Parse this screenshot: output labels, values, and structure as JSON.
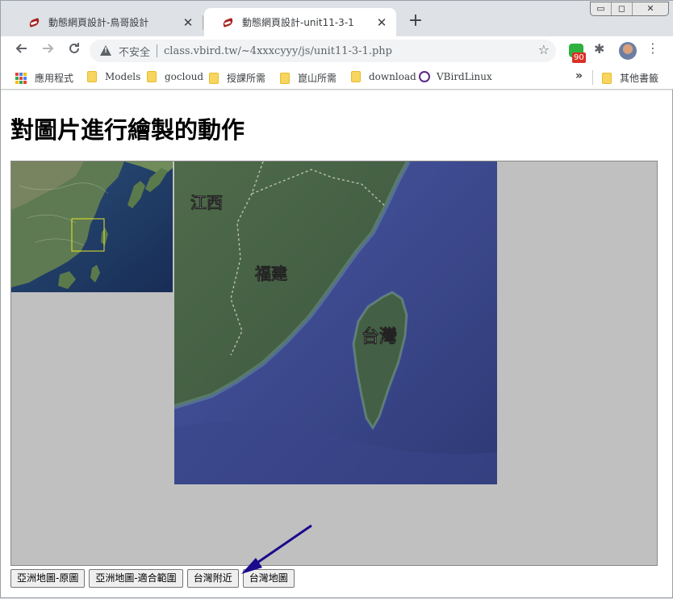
{
  "tabs": [
    {
      "title": "動態網頁設計-鳥哥設計",
      "active": false
    },
    {
      "title": "動態網頁設計-unit11-3-1",
      "active": true
    }
  ],
  "window_controls": {
    "minimize": "▭",
    "maximize": "◻",
    "close": "✕"
  },
  "toolbar": {
    "security_label": "不安全",
    "url": "class.vbird.tw/~4xxxcyyy/js/unit11-3-1.php",
    "extension_badge": "90"
  },
  "bookmarks": {
    "items": [
      "應用程式",
      "Models",
      "gocloud",
      "授課所需",
      "崑山所需",
      "download",
      "VBirdLinux"
    ],
    "more": "»",
    "other": "其他書籤"
  },
  "page": {
    "heading": "對圖片進行繪製的動作",
    "map_labels": {
      "jiangxi": "江西",
      "fujian": "福建",
      "taiwan": "台灣"
    },
    "buttons": [
      "亞洲地圖-原圖",
      "亞洲地圖-適合範圍",
      "台灣附近",
      "台灣地圖"
    ]
  },
  "colors": {
    "canvas_bg": "#c0c0c0",
    "selection_box": "#e6e62b",
    "annotation_arrow": "#1a0a8c"
  }
}
